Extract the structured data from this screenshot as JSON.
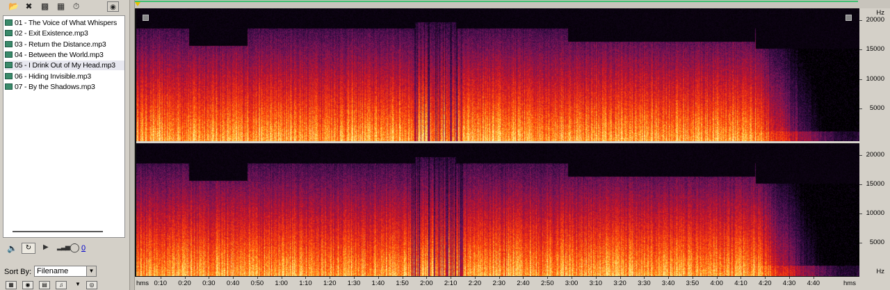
{
  "files": [
    {
      "name": "01 - The Voice of What Whispers",
      "selected": false
    },
    {
      "name": "02 - Exit Existence.mp3",
      "selected": false
    },
    {
      "name": "03 - Return the Distance.mp3",
      "selected": false
    },
    {
      "name": "04 - Between the World.mp3",
      "selected": false
    },
    {
      "name": "05 - I Drink Out of My Head.mp3",
      "selected": true
    },
    {
      "name": "06 - Hiding Invisible.mp3",
      "selected": false
    },
    {
      "name": "07 - By the Shadows.mp3",
      "selected": false
    }
  ],
  "toolbar": {
    "icons": [
      "open-folder-icon",
      "close-file-icon",
      "import-icon",
      "insert-multitrack-icon",
      "timer-icon",
      "view-options-icon"
    ]
  },
  "transport": {
    "volume_value": "0"
  },
  "sort": {
    "label": "Sort By:",
    "value": "Filename"
  },
  "bottom_icons": [
    "multitrack-icon",
    "lock-icon",
    "film-icon",
    "music-icon",
    "filter-icon",
    "cd-icon"
  ],
  "spectral": {
    "y_unit": "Hz",
    "y_ticks": [
      "20000",
      "15000",
      "10000",
      "5000"
    ],
    "y_max": 22050,
    "x_unit": "hms",
    "x_ticks": [
      "0:10",
      "0:20",
      "0:30",
      "0:40",
      "0:50",
      "1:00",
      "1:10",
      "1:20",
      "1:30",
      "1:40",
      "1:50",
      "2:00",
      "2:10",
      "2:20",
      "2:30",
      "2:40",
      "2:50",
      "3:00",
      "3:10",
      "3:20",
      "3:30",
      "3:40",
      "3:50",
      "4:00",
      "4:10",
      "4:20",
      "4:30",
      "4:40"
    ],
    "x_ticks_seconds": [
      10,
      20,
      30,
      40,
      50,
      60,
      70,
      80,
      90,
      100,
      110,
      120,
      130,
      140,
      150,
      160,
      170,
      180,
      190,
      200,
      210,
      220,
      230,
      240,
      250,
      260,
      270,
      280
    ],
    "duration_seconds": 295
  },
  "colors": {
    "hot": "#ffe070",
    "warm": "#ff3a10",
    "mid": "#a01840",
    "cool": "#3a1050",
    "background": "#000000",
    "progress": "#3ec070"
  }
}
